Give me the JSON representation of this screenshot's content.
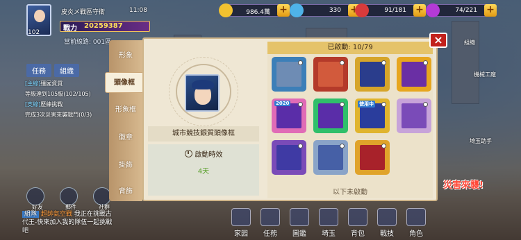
{
  "hud": {
    "level": "102",
    "player_name": "皮炎メ戰區守衛",
    "time": "11:08",
    "power_label": "戰力",
    "power_value": "20259387",
    "sub_line": "當前線路: 001區"
  },
  "resources": [
    {
      "name": "gold",
      "value": "986.4萬",
      "color": "#f2c230"
    },
    {
      "name": "diamond",
      "value": "330",
      "color": "#4fb3e8"
    },
    {
      "name": "stamina",
      "value": "91/181",
      "color": "#d93b3b"
    },
    {
      "name": "ticket",
      "value": "74/221",
      "color": "#b43ad6"
    }
  ],
  "quest": {
    "tabs": [
      "任務",
      "組織"
    ],
    "lines": [
      {
        "tag": "[主線]",
        "text": "殭屍資質"
      },
      {
        "tag": "",
        "text": "等級達到105級(102/105)"
      },
      {
        "tag": "[支線]",
        "text": "歷練挑戰"
      },
      {
        "tag": "",
        "text": "完成3次災害來襲戰鬥(0/3)"
      }
    ]
  },
  "chat": {
    "tag": "組隊",
    "who": "超帥氣空戰",
    "text": "我正在挑戰古代王-快來加入我的隊伍一起挑戰吧"
  },
  "left_icons": [
    "好友",
    "郵件",
    "社群"
  ],
  "bottom_bar": [
    "家园",
    "任務",
    "圖鑑",
    "埼玉",
    "背包",
    "戰技",
    "角色"
  ],
  "right_labels": {
    "workshop": "機械工廠",
    "saitama": "埼玉助手",
    "group": "組織"
  },
  "disaster": "災害來襲!",
  "modal": {
    "side_tabs": [
      "形象",
      "頭像框",
      "形象框",
      "徽章",
      "掛飾",
      "背飾"
    ],
    "active_tab": "頭像框",
    "frame_name": "城市競技銀質頭像框",
    "effect_label": "啟動時效",
    "effect_value": "4天",
    "activated_header": "已啟動: 10/79",
    "unused_label": "以下未啟動",
    "close_symbol": "×"
  },
  "frames": [
    {
      "row": 0,
      "col": 0,
      "outer": "#3c7fb8",
      "inner": "#6e8cb4",
      "badge": ""
    },
    {
      "row": 0,
      "col": 1,
      "outer": "#b43a2a",
      "inner": "#d25a3c",
      "badge": ""
    },
    {
      "row": 0,
      "col": 2,
      "outer": "#d6a52a",
      "inner": "#2a3d8c",
      "badge": ""
    },
    {
      "row": 0,
      "col": 3,
      "outer": "#e7a61e",
      "inner": "#6a2fa4",
      "badge": ""
    },
    {
      "row": 1,
      "col": 0,
      "outer": "#e06bb6",
      "inner": "#5a2da8",
      "badge": "2020"
    },
    {
      "row": 1,
      "col": 1,
      "outer": "#2fbf6a",
      "inner": "#5a2da8",
      "badge": ""
    },
    {
      "row": 1,
      "col": 2,
      "outer": "#e0b42e",
      "inner": "#2a3d9c",
      "badge": "使用中"
    },
    {
      "row": 1,
      "col": 3,
      "outer": "#c7a3d9",
      "inner": "#7a4bb8",
      "badge": ""
    },
    {
      "row": 2,
      "col": 0,
      "outer": "#7a4bb8",
      "inner": "#3f3aa4",
      "badge": ""
    },
    {
      "row": 2,
      "col": 1,
      "outer": "#8aa4c8",
      "inner": "#4660a6",
      "badge": ""
    },
    {
      "row": 2,
      "col": 2,
      "outer": "#e0a32a",
      "inner": "#a8222a",
      "badge": ""
    }
  ]
}
